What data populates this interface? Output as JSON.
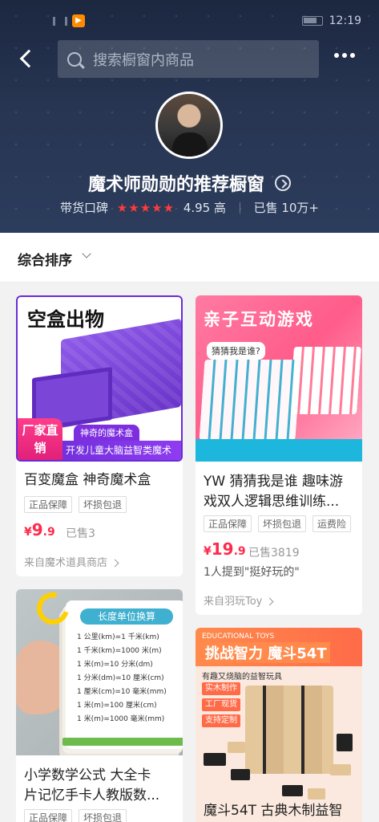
{
  "status_bar": {
    "time": "12:19",
    "app_badge": "▶"
  },
  "header": {
    "search_placeholder": "搜索橱窗内商品",
    "shop_name": "魔术师勋勋的推荐橱窗",
    "reputation_label": "带货口碑",
    "stars": "★★★★★",
    "rating": "4.95 高",
    "sold": "已售 10万+"
  },
  "sort": {
    "label": "综合排序"
  },
  "products": [
    {
      "image_text": {
        "headline": "空盒出物",
        "badge": "厂家直销",
        "band_top": "神奇的魔术盒",
        "band": "开发儿童大脑益智类魔术"
      },
      "title": "百变魔盒 神奇魔术盒",
      "tags": [
        "正品保障",
        "坏损包退"
      ],
      "price_symbol": "¥",
      "price_int": "9",
      "price_dec": ".9",
      "sold": "已售3",
      "from": "来自魔术道具商店"
    },
    {
      "image_text": {
        "headline": "亲子互动游戏",
        "sub": "猜猜我是谁?"
      },
      "title_line1": "YW 猜猜我是谁 趣味游",
      "title_line2": "戏双人逻辑思维训练...",
      "tags": [
        "正品保障",
        "坏损包退",
        "运费险"
      ],
      "price_symbol": "¥",
      "price_int": "19",
      "price_dec": ".9",
      "sold": "已售3819",
      "note": "1人提到\"挺好玩的\"",
      "from": "来自羽玩Toy"
    },
    {
      "image_text": {
        "card_head": "长度单位换算",
        "lines": [
          "1 公里(km)=1 千米(km)",
          "1 千米(km)=1000 米(m)",
          "1 米(m)=10 分米(dm)",
          "1 分米(dm)=10 厘米(cm)",
          "1 厘米(cm)=10 毫米(mm)",
          "1 米(m)=100 厘米(cm)",
          "1 米(m)=1000 毫米(mm)"
        ]
      },
      "title_line1": "小学数学公式  大全卡",
      "title_line2": "片记忆手卡人教版数...",
      "tags": [
        "正品保障",
        "坏损包退"
      ]
    },
    {
      "image_text": {
        "small": "EDUCATIONAL TOYS",
        "headline": "挑战智力 魔斗54T",
        "sub": "有趣又烧脑的益智玩具",
        "pills": [
          "实木制作",
          "工厂现货",
          "支持定制"
        ]
      },
      "title": "魔斗54T 古典木制益智"
    }
  ]
}
